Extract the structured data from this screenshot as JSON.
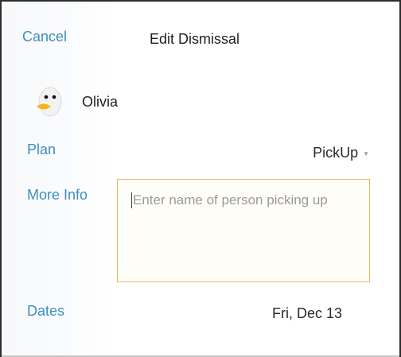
{
  "header": {
    "cancel_label": "Cancel",
    "title": "Edit Dismissal"
  },
  "student": {
    "name": "Olivia",
    "avatar_icon": "duck-avatar-icon"
  },
  "plan": {
    "label": "Plan",
    "selected": "PickUp"
  },
  "more_info": {
    "label": "More Info",
    "value": "",
    "placeholder": "Enter name of person picking up"
  },
  "dates": {
    "label": "Dates",
    "value": "Fri, Dec 13"
  },
  "colors": {
    "accent": "#3e8fbe",
    "input_border": "#e8b860"
  }
}
